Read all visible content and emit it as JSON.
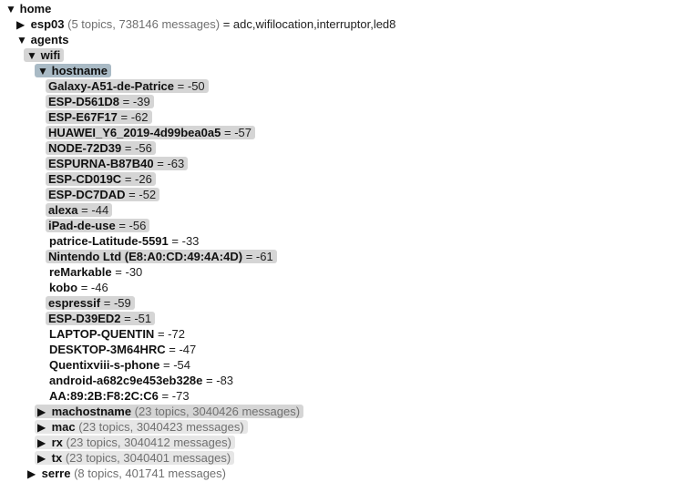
{
  "tree": {
    "home": {
      "arrow": "▼",
      "name": "home"
    },
    "esp03": {
      "arrow": "▶",
      "name": "esp03",
      "meta": "(5 topics, 738146 messages)",
      "eq": "=",
      "value": "adc,wifilocation,interruptor,led8"
    },
    "agents": {
      "arrow": "▼",
      "name": "agents"
    },
    "wifi": {
      "arrow": "▼",
      "name": "wifi"
    },
    "hostname": {
      "arrow": "▼",
      "name": "hostname"
    },
    "hostnames": [
      {
        "name": "Galaxy-A51-de-Patrice",
        "eq": "=",
        "value": "-50"
      },
      {
        "name": "ESP-D561D8",
        "eq": "=",
        "value": "-39"
      },
      {
        "name": "ESP-E67F17",
        "eq": "=",
        "value": "-62"
      },
      {
        "name": "HUAWEI_Y6_2019-4d99bea0a5",
        "eq": "=",
        "value": "-57"
      },
      {
        "name": "NODE-72D39",
        "eq": "=",
        "value": "-56"
      },
      {
        "name": "ESPURNA-B87B40",
        "eq": "=",
        "value": "-63"
      },
      {
        "name": "ESP-CD019C",
        "eq": "=",
        "value": "-26"
      },
      {
        "name": "ESP-DC7DAD",
        "eq": "=",
        "value": "-52"
      },
      {
        "name": "alexa",
        "eq": "=",
        "value": "-44"
      },
      {
        "name": "iPad-de-use",
        "eq": "=",
        "value": "-56"
      },
      {
        "name": "patrice-Latitude-5591",
        "eq": "=",
        "value": "-33"
      },
      {
        "name": "Nintendo Ltd (E8:A0:CD:49:4A:4D)",
        "eq": "=",
        "value": "-61"
      },
      {
        "name": "reMarkable",
        "eq": "=",
        "value": "-30"
      },
      {
        "name": "kobo",
        "eq": "=",
        "value": "-46"
      },
      {
        "name": "espressif",
        "eq": "=",
        "value": "-59"
      },
      {
        "name": "ESP-D39ED2",
        "eq": "=",
        "value": "-51"
      },
      {
        "name": "LAPTOP-QUENTIN",
        "eq": "=",
        "value": "-72"
      },
      {
        "name": "DESKTOP-3M64HRC",
        "eq": "=",
        "value": "-47"
      },
      {
        "name": "Quentixviii-s-phone",
        "eq": "=",
        "value": "-54"
      },
      {
        "name": "android-a682c9e453eb328e",
        "eq": "=",
        "value": "-83"
      },
      {
        "name": "AA:89:2B:F8:2C:C6",
        "eq": "=",
        "value": "-73"
      }
    ],
    "machostname": {
      "arrow": "▶",
      "name": "machostname",
      "meta": "(23 topics, 3040426 messages)"
    },
    "mac": {
      "arrow": "▶",
      "name": "mac",
      "meta": "(23 topics, 3040423 messages)"
    },
    "rx": {
      "arrow": "▶",
      "name": "rx",
      "meta": "(23 topics, 3040412 messages)"
    },
    "tx": {
      "arrow": "▶",
      "name": "tx",
      "meta": "(23 topics, 3040401 messages)"
    },
    "serre": {
      "arrow": "▶",
      "name": "serre",
      "meta": "(8 topics, 401741 messages)"
    }
  }
}
